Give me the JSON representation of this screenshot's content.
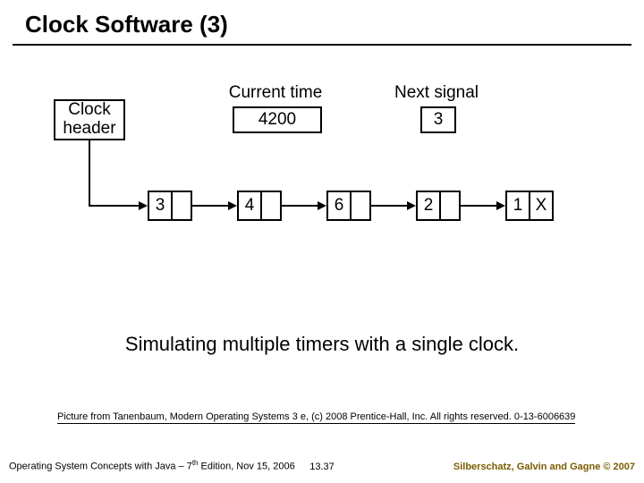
{
  "title": "Clock Software (3)",
  "diagram": {
    "current_time_label": "Current time",
    "next_signal_label": "Next signal",
    "current_time_value": "4200",
    "next_signal_value": "3",
    "clock_header_label": "Clock\nheader",
    "nodes": [
      "3",
      "4",
      "6",
      "2",
      "1"
    ],
    "terminator": "X"
  },
  "caption": "Simulating multiple timers with a single clock.",
  "credit": "Picture from Tanenbaum, Modern Operating Systems 3 e, (c) 2008 Prentice-Hall, Inc. All rights reserved. 0-13-6006639",
  "footer": {
    "left_a": "Operating System Concepts with Java – 7",
    "left_sup": "th",
    "left_b": " Edition, Nov 15, 2006",
    "center": "13.37",
    "right": "Silberschatz, Galvin and Gagne © 2007"
  }
}
